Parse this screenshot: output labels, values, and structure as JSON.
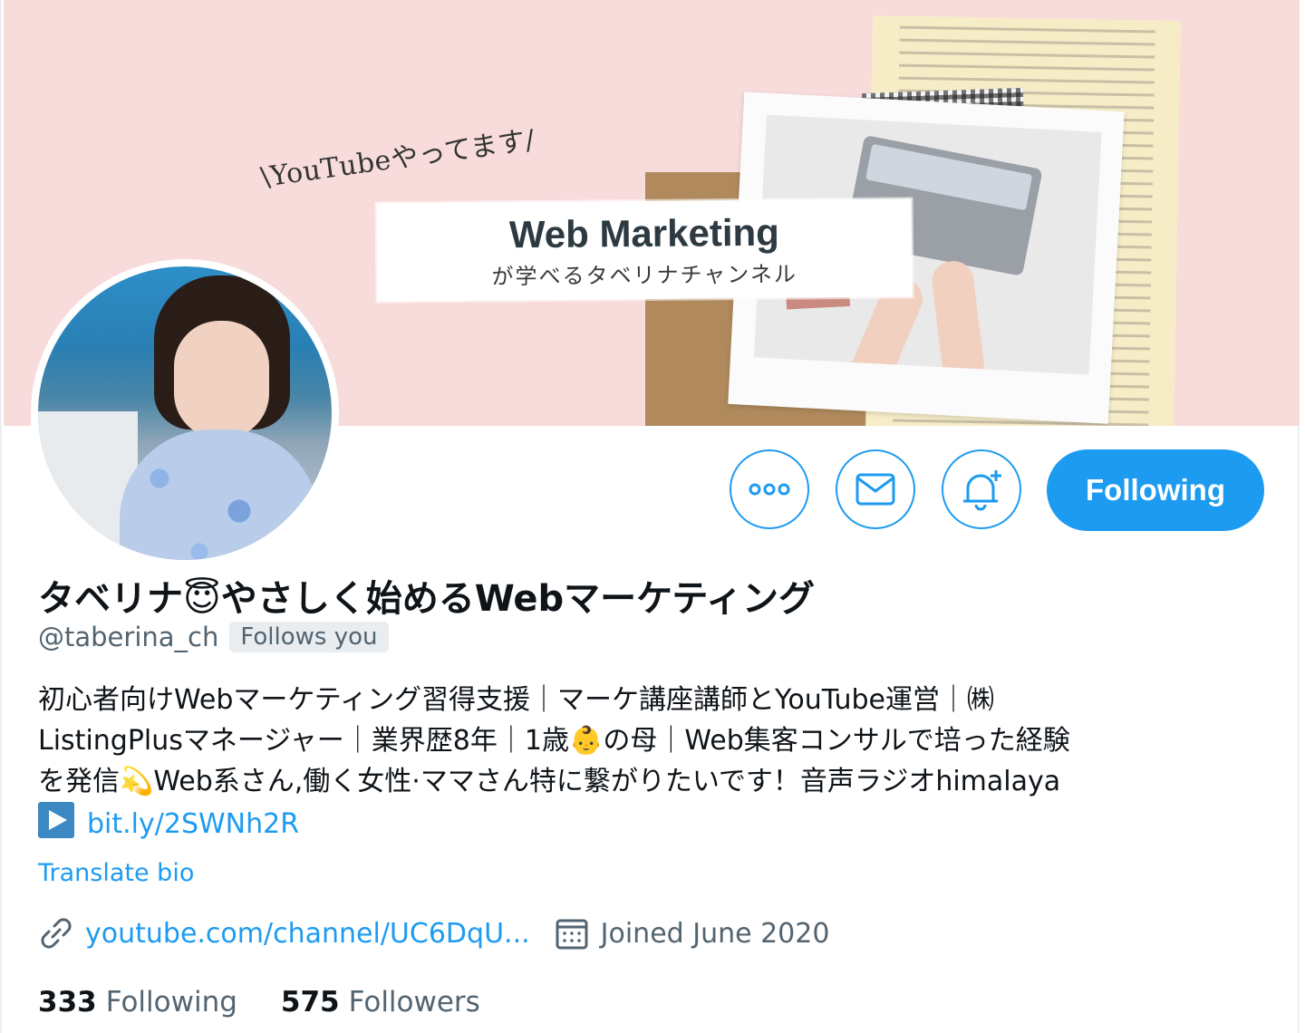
{
  "banner": {
    "caption": "\\YouTubeやってます/",
    "title": "Web Marketing",
    "subtitle": "が学べるタベリナチャンネル"
  },
  "actions": {
    "more_icon": "more-icon",
    "message_icon": "mail-icon",
    "notify_icon": "bell-plus-icon",
    "follow_label": "Following"
  },
  "profile": {
    "name_before_emoji": "タベリナ",
    "name_emoji": "😇",
    "name_after_emoji": "やさしく始めるWebマーケティング",
    "handle": "@taberina_ch",
    "follows_you": "Follows you"
  },
  "bio": {
    "line1": "初心者向けWebマーケティング習得支援｜マーケ講座講師とYouTube運営｜㈱",
    "line2_a": "ListingPlusマネージャー｜業界歴8年｜1歳",
    "line2_emoji": "👶",
    "line2_b": "の母｜Web集客コンサルで培った経験",
    "line3_a": "を発信",
    "line3_emoji": "💫",
    "line3_b": "Web系さん,働く女性·ママさん特に繋がりたいです！音声ラジオhimalaya",
    "link": "bit.ly/2SWNh2R"
  },
  "translate_label": "Translate bio",
  "meta": {
    "url": "youtube.com/channel/UC6DqU...",
    "joined": "Joined June 2020"
  },
  "stats": {
    "following_count": "333",
    "following_label": "Following",
    "followers_count": "575",
    "followers_label": "Followers"
  },
  "colors": {
    "accent": "#1d9bf0",
    "banner_bg": "#f8dcdc",
    "muted_text": "#536471"
  }
}
